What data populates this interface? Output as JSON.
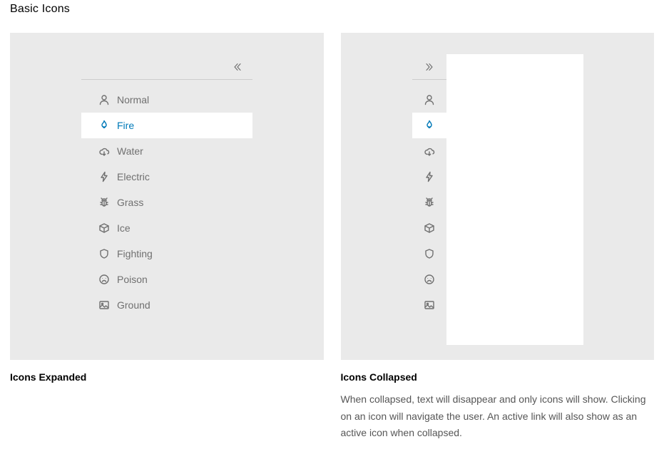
{
  "section_title": "Basic Icons",
  "expanded": {
    "caption": "Icons Expanded",
    "toggle_icon": "chevrons-left",
    "items": [
      {
        "icon": "user",
        "label": "Normal",
        "active": false
      },
      {
        "icon": "flame",
        "label": "Fire",
        "active": true
      },
      {
        "icon": "cloud",
        "label": "Water",
        "active": false
      },
      {
        "icon": "bolt",
        "label": "Electric",
        "active": false
      },
      {
        "icon": "bug",
        "label": "Grass",
        "active": false
      },
      {
        "icon": "cube",
        "label": "Ice",
        "active": false
      },
      {
        "icon": "shield",
        "label": "Fighting",
        "active": false
      },
      {
        "icon": "sad",
        "label": "Poison",
        "active": false
      },
      {
        "icon": "image",
        "label": "Ground",
        "active": false
      }
    ]
  },
  "collapsed": {
    "caption": "Icons Collapsed",
    "description": "When collapsed, text will disappear and only icons will show. Clicking on an icon will navigate the user. An active link will also show as an active icon when collapsed.",
    "toggle_icon": "chevrons-right",
    "items": [
      {
        "icon": "user",
        "active": false
      },
      {
        "icon": "flame",
        "active": true
      },
      {
        "icon": "cloud",
        "active": false
      },
      {
        "icon": "bolt",
        "active": false
      },
      {
        "icon": "bug",
        "active": false
      },
      {
        "icon": "cube",
        "active": false
      },
      {
        "icon": "shield",
        "active": false
      },
      {
        "icon": "sad",
        "active": false
      },
      {
        "icon": "image",
        "active": false
      }
    ]
  }
}
